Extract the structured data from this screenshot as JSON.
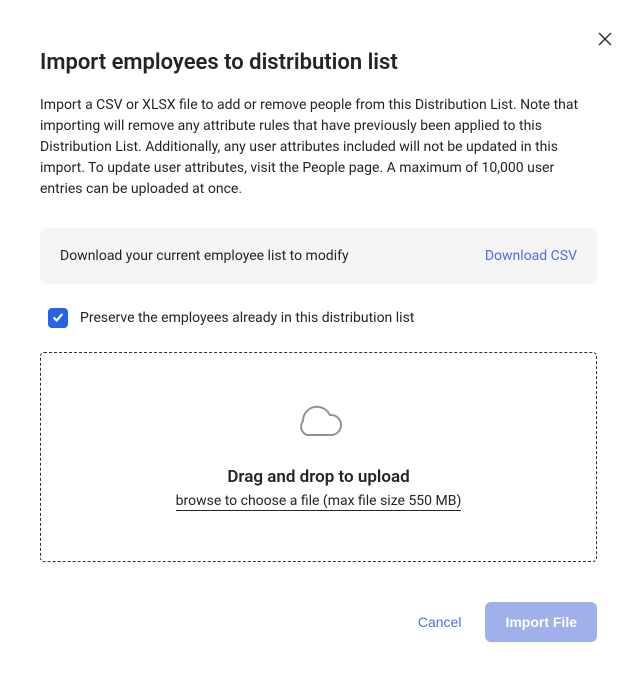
{
  "dialog": {
    "title": "Import employees to distribution list",
    "description": "Import a CSV or XLSX file to add or remove people from this Distribution List. Note that importing will remove any attribute rules that have previously been applied to this Distribution List. Additionally, any user attributes included will not be updated in this import. To update user attributes, visit the People page. A maximum of 10,000 user entries can be uploaded at once."
  },
  "downloadBox": {
    "text": "Download your current employee list to modify",
    "linkLabel": "Download CSV"
  },
  "checkbox": {
    "checked": true,
    "label": "Preserve the employees already in this distribution list"
  },
  "dropzone": {
    "title": "Drag and drop to upload",
    "subtitle": "browse to choose a file (max file size 550 MB)"
  },
  "footer": {
    "cancelLabel": "Cancel",
    "importLabel": "Import File"
  }
}
